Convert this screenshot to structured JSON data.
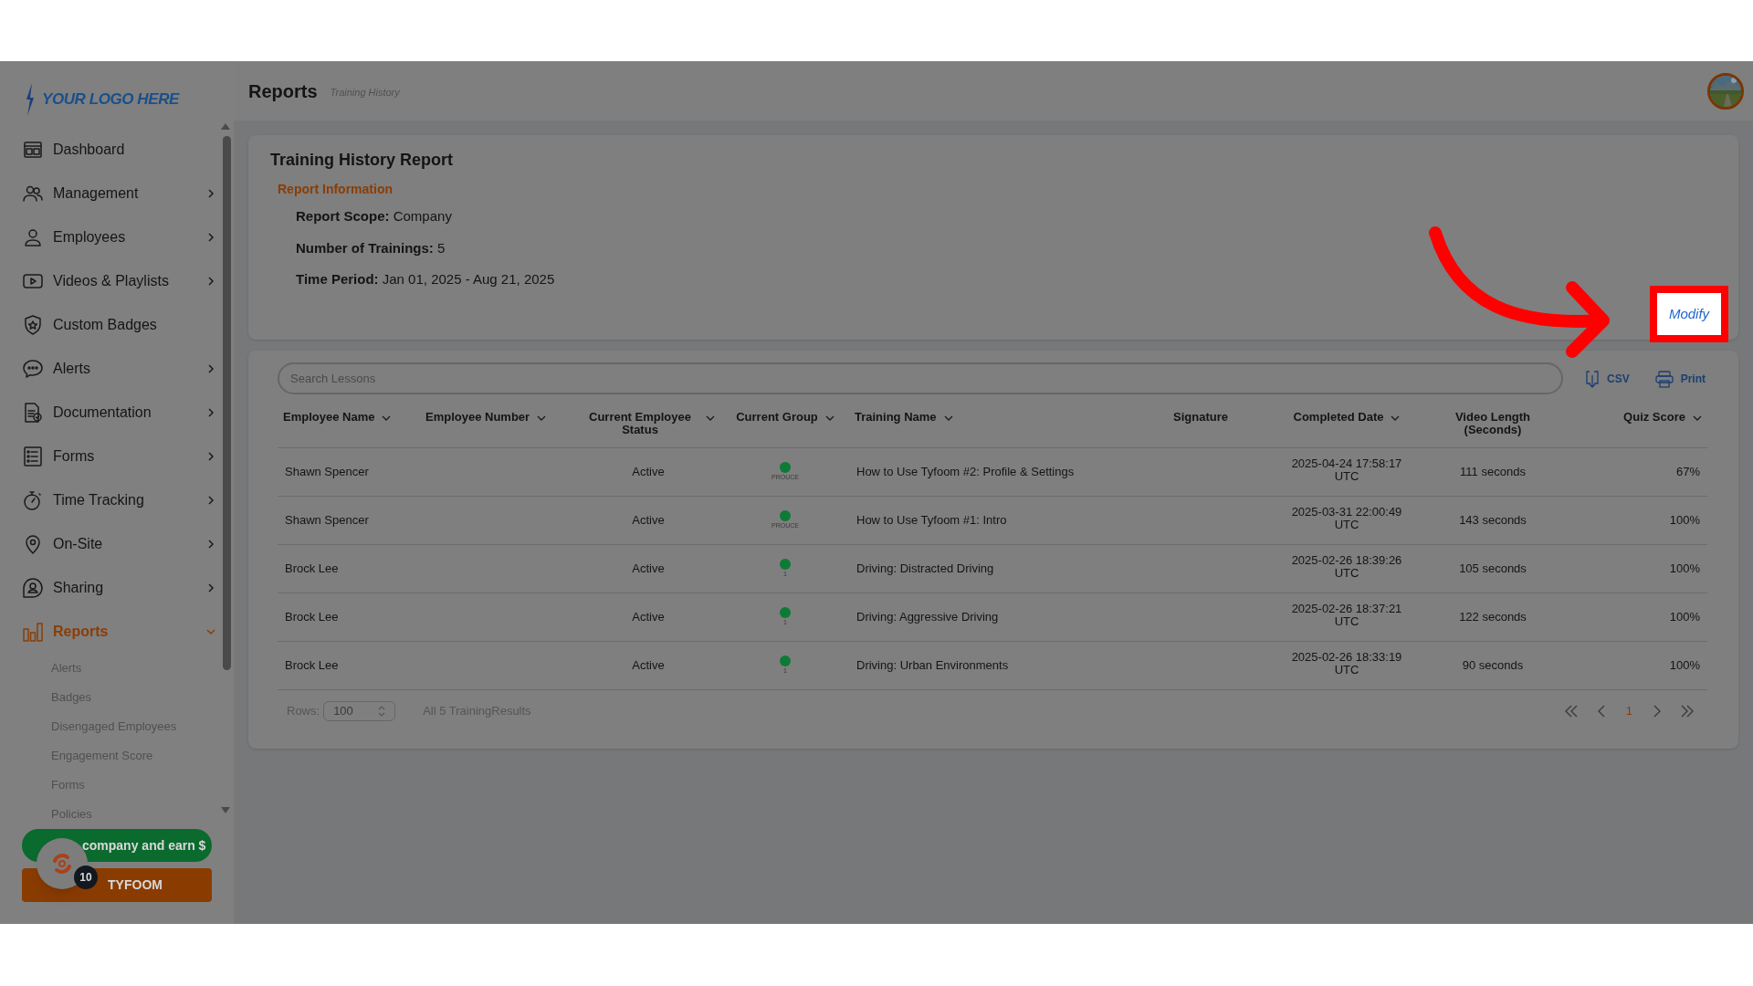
{
  "sidebar": {
    "logo": "YOUR LOGO HERE",
    "items": [
      {
        "label": "Dashboard",
        "selected": false
      },
      {
        "label": "Management",
        "selected": false,
        "expanded": false
      },
      {
        "label": "Employees",
        "selected": false,
        "expanded": false
      },
      {
        "label": "Videos & Playlists",
        "selected": false,
        "expanded": false
      },
      {
        "label": "Custom Badges",
        "selected": false
      },
      {
        "label": "Alerts",
        "selected": false,
        "expanded": false
      },
      {
        "label": "Documentation",
        "selected": false,
        "expanded": false
      },
      {
        "label": "Forms",
        "selected": false,
        "expanded": false
      },
      {
        "label": "Time Tracking",
        "selected": false,
        "expanded": false
      },
      {
        "label": "On-Site",
        "selected": false,
        "expanded": false
      },
      {
        "label": "Sharing",
        "selected": false,
        "expanded": false
      },
      {
        "label": "Reports",
        "selected": true,
        "expanded": true,
        "children": [
          {
            "label": "Alerts"
          },
          {
            "label": "Badges"
          },
          {
            "label": "Disengaged Employees"
          },
          {
            "label": "Engagement Score"
          },
          {
            "label": "Forms"
          },
          {
            "label": "Policies"
          }
        ]
      }
    ],
    "refer_button": "company and earn $",
    "brand_button": "TYFOOM",
    "notification_badge": "10"
  },
  "header": {
    "title": "Reports",
    "subtitle": "Training History"
  },
  "report": {
    "title": "Training History Report",
    "section": "Report Information",
    "fields": [
      {
        "label": "Report Scope:",
        "value": "Company"
      },
      {
        "label": "Number of Trainings:",
        "value": "5"
      },
      {
        "label": "Time Period:",
        "value": "Jan 01, 2025 - Aug 21, 2025"
      }
    ],
    "modify_button": "Modify"
  },
  "toolbar": {
    "search_placeholder": "Search Lessons",
    "actions": [
      {
        "label": "CSV",
        "kind": "download"
      },
      {
        "label": "Print",
        "kind": "print"
      }
    ]
  },
  "table": {
    "columns": [
      {
        "label": "Employee Name",
        "sortable": true
      },
      {
        "label": "Employee Number",
        "sortable": true
      },
      {
        "label": "Current Employee Status",
        "sortable": true
      },
      {
        "label": "Current Group",
        "sortable": true
      },
      {
        "label": "Training Name",
        "sortable": true
      },
      {
        "label": "Signature",
        "sortable": false
      },
      {
        "label": "Completed Date",
        "sortable": true
      },
      {
        "label": "Video Length (Seconds)",
        "sortable": false
      },
      {
        "label": "Quiz Score",
        "sortable": true
      }
    ],
    "rows": [
      {
        "employee_name": "Shawn Spencer",
        "status": "Active",
        "group": "PROUCE",
        "training_name": "How to Use Tyfoom #2: Profile & Settings",
        "completed_date": "2025-04-24 17:58:17 UTC",
        "video_length": "111 seconds",
        "quiz_score": "67%"
      },
      {
        "employee_name": "Shawn Spencer",
        "status": "Active",
        "group": "PROUCE",
        "training_name": "How to Use Tyfoom #1: Intro",
        "completed_date": "2025-03-31 22:00:49 UTC",
        "video_length": "143 seconds",
        "quiz_score": "100%"
      },
      {
        "employee_name": "Brock Lee",
        "status": "Active",
        "group": "1",
        "training_name": "Driving: Distracted Driving",
        "completed_date": "2025-02-26 18:39:26 UTC",
        "video_length": "105 seconds",
        "quiz_score": "100%"
      },
      {
        "employee_name": "Brock Lee",
        "status": "Active",
        "group": "1",
        "training_name": "Driving: Aggressive Driving",
        "completed_date": "2025-02-26 18:37:21 UTC",
        "video_length": "122 seconds",
        "quiz_score": "100%"
      },
      {
        "employee_name": "Brock Lee",
        "status": "Active",
        "group": "1",
        "training_name": "Driving: Urban Environments",
        "completed_date": "2025-02-26 18:33:19 UTC",
        "video_length": "90 seconds",
        "quiz_score": "100%"
      }
    ]
  },
  "footer": {
    "rows_label": "Rows:",
    "rows_value": "100",
    "summary": "All 5 TrainingResults"
  },
  "pagination": {
    "pages": [
      {
        "label": "1",
        "selected": true
      }
    ]
  }
}
